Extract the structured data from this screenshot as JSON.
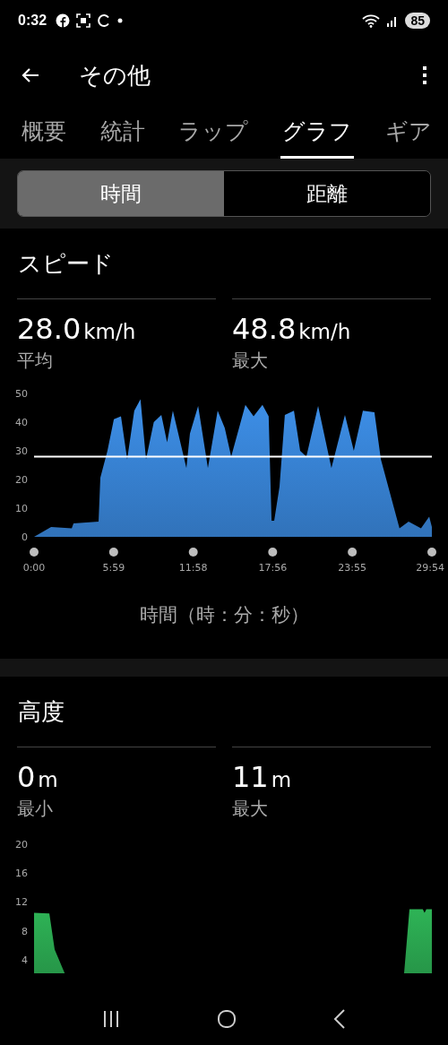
{
  "status_bar": {
    "time": "0:32",
    "battery": "85"
  },
  "app_bar": {
    "title": "その他"
  },
  "tabs": [
    {
      "label": "概要",
      "selected": false
    },
    {
      "label": "統計",
      "selected": false
    },
    {
      "label": "ラップ",
      "selected": false
    },
    {
      "label": "グラフ",
      "selected": true
    },
    {
      "label": "ギア",
      "selected": false
    }
  ],
  "axis_toggle": [
    {
      "label": "時間",
      "selected": true
    },
    {
      "label": "距離",
      "selected": false
    }
  ],
  "sections": [
    {
      "title": "スピード",
      "stats": [
        {
          "value": "28.0",
          "unit": "km/h",
          "label": "平均"
        },
        {
          "value": "48.8",
          "unit": "km/h",
          "label": "最大"
        }
      ],
      "chart_data": {
        "type": "area",
        "xlabel": "時間（時：分：秒）",
        "x": [
          0,
          77,
          170,
          178,
          291,
          299,
          331,
          360,
          392,
          420,
          452,
          480,
          505,
          540,
          574,
          600,
          626,
          687,
          703,
          740,
          784,
          828,
          860,
          889,
          953,
          990,
          1030,
          1058,
          1071,
          1083,
          1107,
          1131,
          1172,
          1200,
          1228,
          1281,
          1341,
          1402,
          1442,
          1483,
          1535,
          1564,
          1648,
          1689,
          1745,
          1782,
          1794
        ],
        "series": [
          {
            "color": "#3d8fe8",
            "values": [
              0,
              3.4,
              3,
              4.7,
              5.3,
              20.6,
              30,
              41,
              42,
              27,
              44,
              48,
              27,
              40,
              42.5,
              33,
              44,
              24,
              36,
              45.6,
              24,
              44,
              38,
              28,
              46,
              42,
              46,
              42,
              5.6,
              5.6,
              17.5,
              42.5,
              44,
              30,
              28,
              45.6,
              24,
              42.5,
              30,
              44,
              43.4,
              27,
              3,
              5.3,
              3,
              7,
              3.4
            ]
          }
        ],
        "xlim": [
          0,
          1794
        ],
        "ylim": [
          0,
          50
        ],
        "yticks": [
          0,
          10,
          20,
          30,
          40,
          50
        ],
        "xticks": [
          {
            "value": 0,
            "label": "0:00"
          },
          {
            "value": 359,
            "label": "5:59"
          },
          {
            "value": 718,
            "label": "11:58"
          },
          {
            "value": 1076,
            "label": "17:56"
          },
          {
            "value": 1435,
            "label": "23:55"
          },
          {
            "value": 1794,
            "label": "29:54"
          }
        ],
        "ref_lines": [
          {
            "axis": "y",
            "value": 28
          }
        ]
      }
    },
    {
      "title": "高度",
      "stats": [
        {
          "value": "0",
          "unit": "m",
          "label": "最小"
        },
        {
          "value": "11",
          "unit": "m",
          "label": "最大"
        }
      ],
      "chart_data": {
        "type": "area",
        "x": [
          0,
          69,
          93,
          137,
          170,
          1644,
          1669,
          1693,
          1753,
          1761,
          1769,
          1794
        ],
        "series": [
          {
            "color": "#2eb356",
            "values": [
              10.5,
              10.4,
              5.4,
              2.2,
              0,
              0,
              2.2,
              11,
              11,
              10.5,
              11,
              11
            ]
          }
        ],
        "xlim": [
          0,
          1794
        ],
        "ylim": [
          0,
          20
        ],
        "yticks": [
          4,
          8,
          12,
          16,
          20
        ]
      }
    }
  ]
}
